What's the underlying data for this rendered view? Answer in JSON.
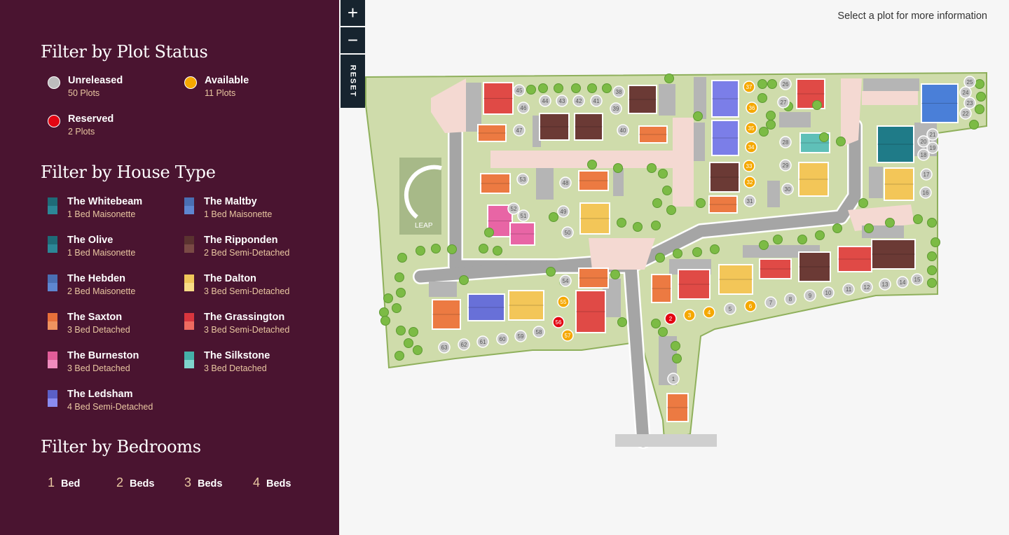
{
  "sidebar": {
    "status_heading": "Filter by Plot Status",
    "statuses": [
      {
        "label": "Unreleased",
        "count": "50 Plots",
        "color": "#bdbdbd"
      },
      {
        "label": "Available",
        "count": "11 Plots",
        "color": "#f5a800"
      },
      {
        "label": "Reserved",
        "count": "2 Plots",
        "color": "#e30613"
      }
    ],
    "house_heading": "Filter by House Type",
    "house_types": [
      {
        "name": "The Whitebeam",
        "desc": "1 Bed Maisonette",
        "c1": "#1f6b78",
        "c2": "#2c8797"
      },
      {
        "name": "The Maltby",
        "desc": "1 Bed Maisonette",
        "c1": "#4a6fb3",
        "c2": "#5e86d0"
      },
      {
        "name": "The Olive",
        "desc": "1 Bed Maisonette",
        "c1": "#1f6b78",
        "c2": "#2c8797"
      },
      {
        "name": "The Ripponden",
        "desc": "2 Bed Semi-Detached",
        "c1": "#5b3330",
        "c2": "#7a4a45"
      },
      {
        "name": "The Hebden",
        "desc": "2 Bed Maisonette",
        "c1": "#4a6fb3",
        "c2": "#5e86d0"
      },
      {
        "name": "The Dalton",
        "desc": "3 Bed Semi-Detached",
        "c1": "#f0c65a",
        "c2": "#f8db86"
      },
      {
        "name": "The Saxton",
        "desc": "3 Bed Detached",
        "c1": "#e8703a",
        "c2": "#f0925f"
      },
      {
        "name": "The Grassington",
        "desc": "3 Bed Semi-Detached",
        "c1": "#d9363e",
        "c2": "#ee6a60"
      },
      {
        "name": "The Burneston",
        "desc": "3 Bed Detached",
        "c1": "#e35d9a",
        "c2": "#f08cbe"
      },
      {
        "name": "The Silkstone",
        "desc": "3 Bed Detached",
        "c1": "#45b0a8",
        "c2": "#7fd4cc"
      },
      {
        "name": "The Ledsham",
        "desc": "4 Bed Semi-Detached",
        "c1": "#5b5fc7",
        "c2": "#8a8cf0"
      }
    ],
    "bed_heading": "Filter by Bedrooms",
    "bedrooms": [
      {
        "num": "1",
        "label": "Bed"
      },
      {
        "num": "2",
        "label": "Beds"
      },
      {
        "num": "3",
        "label": "Beds"
      },
      {
        "num": "4",
        "label": "Beds"
      }
    ]
  },
  "controls": {
    "zoom_in": "+",
    "zoom_out": "−",
    "reset": "RESET"
  },
  "map": {
    "hint": "Select a plot for more information",
    "leap_label": "LEAP",
    "plots": [
      {
        "n": "1",
        "s": "u"
      },
      {
        "n": "2",
        "s": "r"
      },
      {
        "n": "3",
        "s": "a"
      },
      {
        "n": "4",
        "s": "a"
      },
      {
        "n": "5",
        "s": "u"
      },
      {
        "n": "6",
        "s": "a"
      },
      {
        "n": "7",
        "s": "u"
      },
      {
        "n": "8",
        "s": "u"
      },
      {
        "n": "9",
        "s": "u"
      },
      {
        "n": "10",
        "s": "u"
      },
      {
        "n": "11",
        "s": "u"
      },
      {
        "n": "12",
        "s": "u"
      },
      {
        "n": "13",
        "s": "u"
      },
      {
        "n": "14",
        "s": "u"
      },
      {
        "n": "15",
        "s": "u"
      },
      {
        "n": "16",
        "s": "u"
      },
      {
        "n": "17",
        "s": "u"
      },
      {
        "n": "18",
        "s": "u"
      },
      {
        "n": "19",
        "s": "u"
      },
      {
        "n": "20",
        "s": "u"
      },
      {
        "n": "21",
        "s": "u"
      },
      {
        "n": "22",
        "s": "u"
      },
      {
        "n": "23",
        "s": "u"
      },
      {
        "n": "24",
        "s": "u"
      },
      {
        "n": "25",
        "s": "u"
      },
      {
        "n": "26",
        "s": "u"
      },
      {
        "n": "27",
        "s": "u"
      },
      {
        "n": "28",
        "s": "u"
      },
      {
        "n": "29",
        "s": "u"
      },
      {
        "n": "30",
        "s": "u"
      },
      {
        "n": "31",
        "s": "u"
      },
      {
        "n": "32",
        "s": "a"
      },
      {
        "n": "33",
        "s": "a"
      },
      {
        "n": "34",
        "s": "a"
      },
      {
        "n": "35",
        "s": "a"
      },
      {
        "n": "36",
        "s": "a"
      },
      {
        "n": "37",
        "s": "a"
      },
      {
        "n": "38",
        "s": "u"
      },
      {
        "n": "39",
        "s": "u"
      },
      {
        "n": "40",
        "s": "u"
      },
      {
        "n": "41",
        "s": "u"
      },
      {
        "n": "42",
        "s": "u"
      },
      {
        "n": "43",
        "s": "u"
      },
      {
        "n": "44",
        "s": "u"
      },
      {
        "n": "45",
        "s": "u"
      },
      {
        "n": "46",
        "s": "u"
      },
      {
        "n": "47",
        "s": "u"
      },
      {
        "n": "48",
        "s": "u"
      },
      {
        "n": "49",
        "s": "u"
      },
      {
        "n": "50",
        "s": "u"
      },
      {
        "n": "51",
        "s": "u"
      },
      {
        "n": "52",
        "s": "u"
      },
      {
        "n": "53",
        "s": "u"
      },
      {
        "n": "54",
        "s": "u"
      },
      {
        "n": "55",
        "s": "a"
      },
      {
        "n": "56",
        "s": "r"
      },
      {
        "n": "57",
        "s": "a"
      },
      {
        "n": "58",
        "s": "u"
      },
      {
        "n": "59",
        "s": "u"
      },
      {
        "n": "60",
        "s": "u"
      },
      {
        "n": "61",
        "s": "u"
      },
      {
        "n": "62",
        "s": "u"
      },
      {
        "n": "63",
        "s": "u"
      }
    ]
  }
}
